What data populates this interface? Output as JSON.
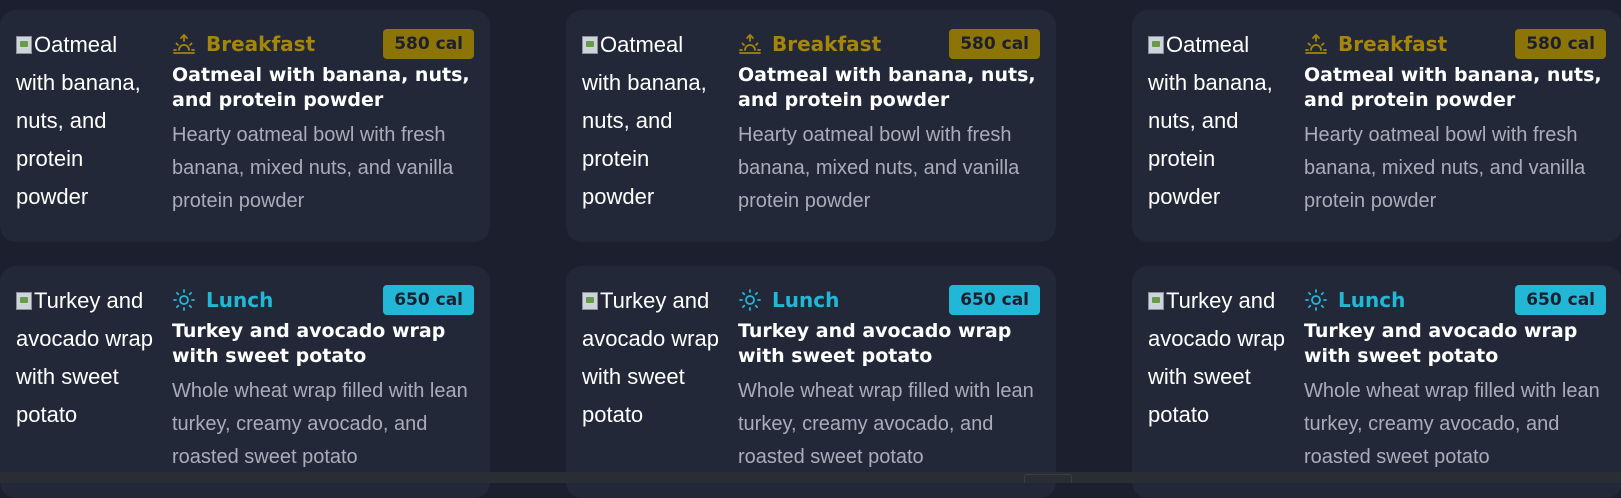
{
  "cards": [
    {
      "image_alt": "Oatmeal with banana, nuts, and protein powder",
      "meal_type": "Breakfast",
      "calories": "580 cal",
      "title": "Oatmeal with banana, nuts, and protein powder",
      "description": "Hearty oatmeal bowl with fresh banana, mixed nuts, and vanilla protein powder",
      "icon": "sunrise-icon",
      "accent": "#a3860a"
    },
    {
      "image_alt": "Oatmeal with banana, nuts, and protein powder",
      "meal_type": "Breakfast",
      "calories": "580 cal",
      "title": "Oatmeal with banana, nuts, and protein powder",
      "description": "Hearty oatmeal bowl with fresh banana, mixed nuts, and vanilla protein powder",
      "icon": "sunrise-icon",
      "accent": "#a3860a"
    },
    {
      "image_alt": "Oatmeal with banana, nuts, and protein powder",
      "meal_type": "Breakfast",
      "calories": "580 cal",
      "title": "Oatmeal with banana, nuts, and protein powder",
      "description": "Hearty oatmeal bowl with fresh banana, mixed nuts, and vanilla protein powder",
      "icon": "sunrise-icon",
      "accent": "#a3860a"
    },
    {
      "image_alt": "Turkey and avocado wrap with sweet potato",
      "meal_type": "Lunch",
      "calories": "650 cal",
      "title": "Turkey and avocado wrap with sweet potato",
      "description": "Whole wheat wrap filled with lean turkey, creamy avocado, and roasted sweet potato",
      "icon": "sun-icon",
      "accent": "#22b7d6"
    },
    {
      "image_alt": "Turkey and avocado wrap with sweet potato",
      "meal_type": "Lunch",
      "calories": "650 cal",
      "title": "Turkey and avocado wrap with sweet potato",
      "description": "Whole wheat wrap filled with lean turkey, creamy avocado, and roasted sweet potato",
      "icon": "sun-icon",
      "accent": "#22b7d6"
    },
    {
      "image_alt": "Turkey and avocado wrap with sweet potato",
      "meal_type": "Lunch",
      "calories": "650 cal",
      "title": "Turkey and avocado wrap with sweet potato",
      "description": "Whole wheat wrap filled with lean turkey, creamy avocado, and roasted sweet potato",
      "icon": "sun-icon",
      "accent": "#22b7d6"
    }
  ]
}
